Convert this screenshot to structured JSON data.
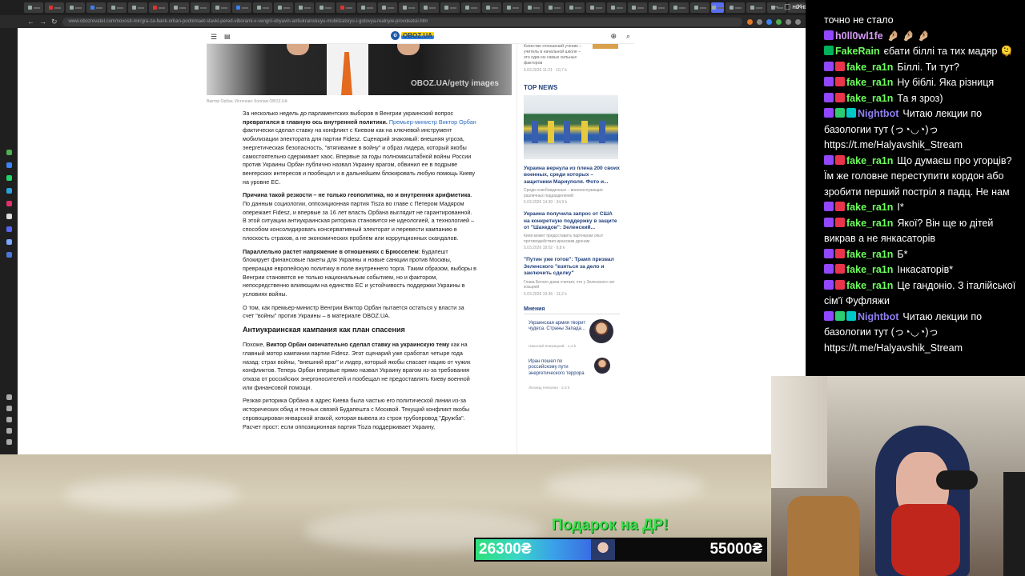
{
  "browser": {
    "url": "www.obozrevatel.com/novosti-mir/gra-za-bank-orban-podnimaet-stavki-pered-viborami-v-vengrii-obyavin-antiukrainskuyu-mobilizatsiyu-i-gotovya-realnyie-provokatsii.htm",
    "active_tab_color": "#5a6df0"
  },
  "site": {
    "logo_text": "OBOZ.UA",
    "image_watermark": "OBOZ.UA/getty images",
    "image_caption": "Виктор Орбан. Источник: Коллаж OBOZ.UA"
  },
  "article": {
    "p1_a": "За несколько недель до парламентских выборов в Венгрии украинский вопрос ",
    "p1_b": "превратился в главную ось внутренней политики.",
    "p1_link": " Премьер-министр Виктор Орбан",
    "p1_c": " фактически сделал ставку на конфликт с Киевом как на ключевой инструмент мобилизации электората для партии Fidesz. Сценарий знакомый: внешняя угроза, энергетическая безопасность, \"втягивание в войну\" и образ лидера, который якобы самостоятельно сдерживает хаос. Впервые за годы полномасштабной войны России против Украины Орбан публично назвал Украину врагом, обвинил ее в подрыве венгерских интересов и пообещал и в дальнейшем блокировать любую помощь Киеву на уровне ЕС.",
    "p2_b": "Причина такой резкости – не только геополитика, но и внутренняя арифметика",
    "p2_c": ". По данным социологии, оппозиционная партия Tisza во главе с Петером Мадяром опережает Fidesz, и впервые за 16 лет власть Орбана выглядит не гарантированной. В этой ситуации антиукраинская риторика становится не идеологией, а технологией – способом консолидировать консервативный электорат и перевести кампанию в плоскость страхов, а не экономических проблем или коррупционных скандалов.",
    "p3_b": "Параллельно растет напряжение в отношениях с Брюсселем",
    "p3_c": ": Будапешт блокирует финансовые пакеты для Украины и новые санкции против Москвы, превращая европейскую политику в поле внутреннего торга. Таким образом, выборы в Венгрии становятся не только национальным событием, но и фактором, непосредственно влияющим на единство ЕС и устойчивость поддержки Украины в условиях войны.",
    "p4": "О том, как премьер-министр Венгрии Виктор Орбан пытается остаться у власти за счет \"войны\" против Украины – в материале OBOZ.UA.",
    "h3": "Антиукраинская кампания как план спасения",
    "p5_a": "Похоже, ",
    "p5_b": "Виктор Орбан окончательно сделал ставку на украинскую тему",
    "p5_c": " как на главный мотор кампании партии Fidesz. Этот сценарий уже сработал четыре года назад: страх войны, \"внешний враг\" и лидер, который якобы спасает нацию от чужих конфликтов. Теперь Орбан впервые прямо назвал Украину врагом из-за требования отказа от российских энергоносителей и пообещал не предоставлять Киеву военной или финансовой помощи.",
    "p6": "Резкая риторика Орбана в адрес Киева была частью его политической линии из-за исторических обид и тесных связей Будапешта с Москвой. Текущий конфликт якобы спровоцирован январской атакой, которая вывела из строя трубопровод \"Дружба\". Расчет прост: если оппозиционная партия Tisza поддерживает Украину,"
  },
  "sidebar": {
    "quality_text": "Качество отношений ученик – учитель в начальной школе – это один из самых сильных факторов",
    "quality_meta": "5.03.2026 11:21 · 10,7 k",
    "top_news": "TOP NEWS",
    "news": [
      {
        "title": "Украина вернула из плена 200 своих военных, среди которых – защитники Мариуполя. Фото и...",
        "sub": "Среди освобожденных – военнослужащие различных подразделений",
        "meta": "5.03.2026 14:30 · 34,9 k"
      },
      {
        "title": "Украина получила запрос от США на конкретную поддержку в защите от \"Шахедов\": Зеленский...",
        "sub": "Киев может предоставить партнерам опыт противодействия иранским дронам",
        "meta": "5.03.2026 18:02 · 9,8 k"
      },
      {
        "title": "\"Путин уже готов\": Трамп призвал Зеленского \"взяться за дело и заключить сделку\"",
        "sub": "Глава Белого дома считает, что у Зеленского нет козырей",
        "meta": "5.03.2026 19:36 · 11,2 k"
      }
    ],
    "opinions_head": "Мнения",
    "opinions": [
      {
        "title": "Украинская армия творит чудеса. Страны Запада...",
        "author": "Николай Княжицкий · 1,4 k"
      },
      {
        "title": "Иран пошел по российскому пути энергетического террора",
        "author": "Леонид Невзлин · 2,4 k"
      }
    ]
  },
  "chat": {
    "messages": [
      {
        "user": "",
        "text": "точно не стало",
        "color": "#ffffff",
        "badges": []
      },
      {
        "user": "h0ll0wl1fe",
        "text": "🤌🏼 🤌🏼 🤌🏼",
        "color": "#d89bf6",
        "badges": [
          "#9147ff"
        ]
      },
      {
        "user": "FakeRain",
        "text": "єбати біллі та тих мадяр 🫠",
        "color": "#6dff5d",
        "badges": [
          "#00b35a"
        ]
      },
      {
        "user": "fake_ra1n",
        "text": "Біллі. Ти тут?",
        "color": "#6dff5d",
        "badges": [
          "#9147ff",
          "#e9344b"
        ]
      },
      {
        "user": "fake_ra1n",
        "text": "Ну біблі. Яка різниця",
        "color": "#6dff5d",
        "badges": [
          "#9147ff",
          "#e9344b"
        ]
      },
      {
        "user": "fake_ra1n",
        "text": "Та я зроз)",
        "color": "#6dff5d",
        "badges": [
          "#9147ff",
          "#e9344b"
        ]
      },
      {
        "user": "Nightbot",
        "text": "Читаю лекции по базологии тут (っ◔◡◔)っ https://t.me/Halyavshik_Stream",
        "color": "#8e7ff0",
        "badges": [
          "#9147ff",
          "#2ecc71",
          "#00c8c8"
        ]
      },
      {
        "user": "fake_ra1n",
        "text": "Що думаєш про угорців? Їм же головне переступити кордон або зробити перший постріл я падц. Не нам",
        "color": "#6dff5d",
        "badges": [
          "#9147ff",
          "#e9344b"
        ]
      },
      {
        "user": "fake_ra1n",
        "text": "І*",
        "color": "#6dff5d",
        "badges": [
          "#9147ff",
          "#e9344b"
        ]
      },
      {
        "user": "fake_ra1n",
        "text": "Якої? Він ще ю дітей викрав а не янкасаторів",
        "color": "#6dff5d",
        "badges": [
          "#9147ff",
          "#e9344b"
        ]
      },
      {
        "user": "fake_ra1n",
        "text": "Б*",
        "color": "#6dff5d",
        "badges": [
          "#9147ff",
          "#e9344b"
        ]
      },
      {
        "user": "fake_ra1n",
        "text": "Інкасаторів*",
        "color": "#6dff5d",
        "badges": [
          "#9147ff",
          "#e9344b"
        ]
      },
      {
        "user": "fake_ra1n",
        "text": "Це гандоніо. З італійської сім'ї Фуфляжи",
        "color": "#6dff5d",
        "badges": [
          "#9147ff",
          "#e9344b"
        ]
      },
      {
        "user": "Nightbot",
        "text": "Читаю лекции по базологии тут (っ◔◡◔)っ https://t.me/Halyavshik_Stream",
        "color": "#8e7ff0",
        "badges": [
          "#9147ff",
          "#2ecc71",
          "#00c8c8"
        ]
      }
    ]
  },
  "donation": {
    "title": "Подарок на ДР!",
    "current": "26300₴",
    "goal": "55000₴",
    "progress": 0.478
  }
}
